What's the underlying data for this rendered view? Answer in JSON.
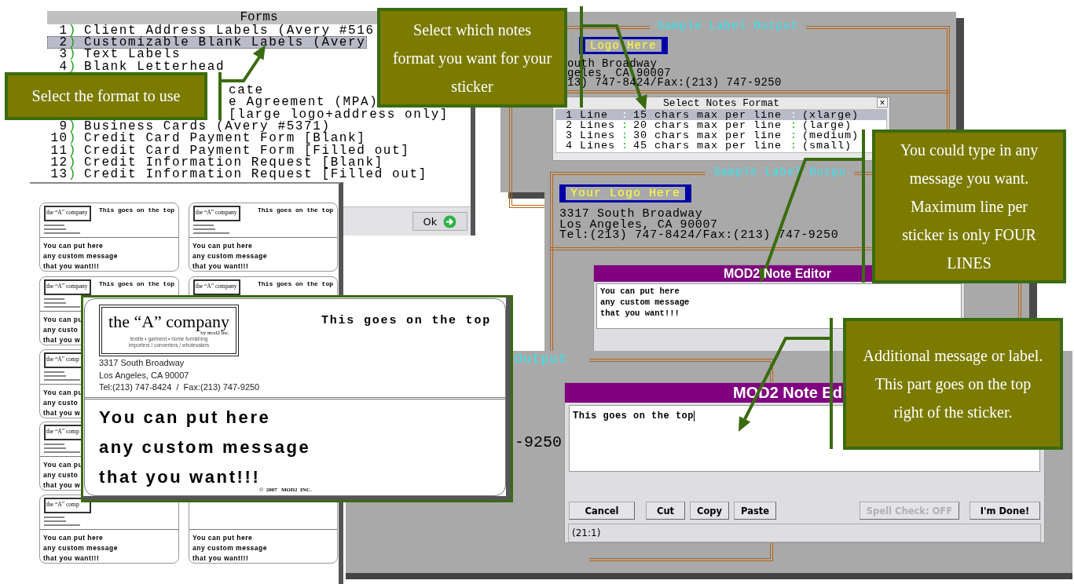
{
  "forms_window": {
    "title": "Forms",
    "items": [
      {
        "number": "1",
        "mark": ")",
        "label": "Client Address Labels (Avery #516",
        "selected": false
      },
      {
        "number": "2",
        "mark": ")",
        "label": "Customizable Blank Labels (Avery",
        "selected": true
      },
      {
        "number": "3",
        "mark": ")",
        "label": "Text Labels",
        "selected": false
      },
      {
        "number": "4",
        "mark": ")",
        "label": "Blank Letterhead",
        "selected": false
      },
      {
        "label": "cate",
        "selected": false
      },
      {
        "label": "e Agreement (MPA)",
        "selected": false
      },
      {
        "label": "[large logo+address only]",
        "selected": false
      },
      {
        "number": "9",
        "mark": ")",
        "label": "Business Cards (Avery #5371)",
        "selected": false
      },
      {
        "number": "10",
        "mark": ")",
        "label": "Credit Card Payment Form [Blank]",
        "selected": false
      },
      {
        "number": "11",
        "mark": ")",
        "label": "Credit Card Payment Form [Filled out]",
        "selected": false
      },
      {
        "number": "12",
        "mark": ")",
        "label": "Credit Information Request [Blank]",
        "selected": false
      },
      {
        "number": "13",
        "mark": ")",
        "label": "Credit Information Request [Filled out]",
        "selected": false
      }
    ],
    "ok_button": "Ok"
  },
  "sample_window_top": {
    "title": "Sample Label Output",
    "logo": "Logo Here",
    "address": [
      "outh Broadway",
      "geles, CA 90007",
      "13) 747-8424/Fax:(213) 747-9250"
    ]
  },
  "notes_format_dialog": {
    "title": "Select Notes Format",
    "close": "×",
    "rows": [
      {
        "cells": [
          "1 Line",
          ":",
          "15 chars max per line",
          ":",
          "(xlarge)"
        ],
        "selected": true
      },
      {
        "cells": [
          "2 Lines",
          ":",
          "20 chars max per line",
          ":",
          "(large)"
        ],
        "selected": false
      },
      {
        "cells": [
          "3 Lines",
          ":",
          "30 chars max per line",
          ":",
          "(medium)"
        ],
        "selected": false
      },
      {
        "cells": [
          "4 Lines",
          ":",
          "45 chars max per line",
          ":",
          "(small)"
        ],
        "selected": false
      }
    ]
  },
  "sample_window_middle": {
    "title": "Sample Label Outpu",
    "logo": "Your Logo Here",
    "address": [
      "3317 South Broadway",
      "Los Angeles, CA 90007",
      "Tel:(213) 747-8424/Fax:(213) 747-9250"
    ]
  },
  "note_editor_back": {
    "title": "MOD2 Note Editor",
    "lines": [
      "You can put here",
      "any custom message",
      "that you want!!!"
    ]
  },
  "sample_window_bottom": {
    "fragments": [
      "Output",
      "-9250"
    ]
  },
  "label_sheet": {
    "labels": [
      {
        "logo": "the “A” company",
        "top_text": "This goes on the top",
        "message": [
          "You can put here",
          "any custom message",
          "that you want!!!"
        ]
      },
      {
        "logo": "the “A” company",
        "top_text": "This goes on the top",
        "message": [
          "You can put here",
          "any custom message",
          "that you want!!!"
        ]
      },
      {
        "logo": "the “A” company",
        "top_text": "This goes on the top",
        "message": [
          "You can pu",
          "any custo",
          "that you w"
        ]
      },
      {
        "logo": "the “A” company",
        "top_text": "This goes on the top"
      },
      {
        "logo": "the “A” comp",
        "message": [
          "You can pu",
          "any custo",
          "that you w"
        ]
      },
      {
        "logo": "the “A” comp",
        "message": [
          "You can pu",
          "any custo",
          "that you w"
        ]
      },
      {
        "logo": "the “A” comp",
        "message": [
          "You can put here",
          "any custom message",
          "that you want!!!"
        ]
      },
      {
        "message": [
          "You can put here",
          "any custom message",
          "that you want!!!"
        ]
      }
    ]
  },
  "label_zoom": {
    "logo": "the “A” company",
    "logo_byline": "by mod2 inc.",
    "tagline": [
      "textile • garment • home furnishing",
      "importers / converters / wholesalers"
    ],
    "address": [
      "3317 South Broadway",
      "Los Angeles, CA 90007",
      "Tel:(213) 747-8424  /  Fax:(213) 747-9250"
    ],
    "top_text": "This goes on the top",
    "message": [
      "You can put here",
      "any custom message",
      "that you want!!!"
    ],
    "footer": "©  2007   MOD2  INC."
  },
  "note_editor_front": {
    "title": "MOD2 Note Ed",
    "text": "This goes on the top",
    "buttons_left": [
      {
        "label": "Cancel",
        "disabled": false
      },
      {
        "label": "Cut",
        "disabled": false
      },
      {
        "label": "Copy",
        "disabled": false
      },
      {
        "label": "Paste",
        "disabled": false
      }
    ],
    "buttons_right": [
      {
        "label": "Spell Check: OFF",
        "disabled": true
      },
      {
        "label": "I'm Done!",
        "disabled": false
      }
    ],
    "status": "(21:1)"
  },
  "callouts": [
    "Select the format to use",
    "Select which notes format you want for your sticker",
    "You could type in any message you want. Maximum line per sticker is only FOUR LINES",
    "Additional message or label.  This part goes on the top right of the sticker."
  ]
}
